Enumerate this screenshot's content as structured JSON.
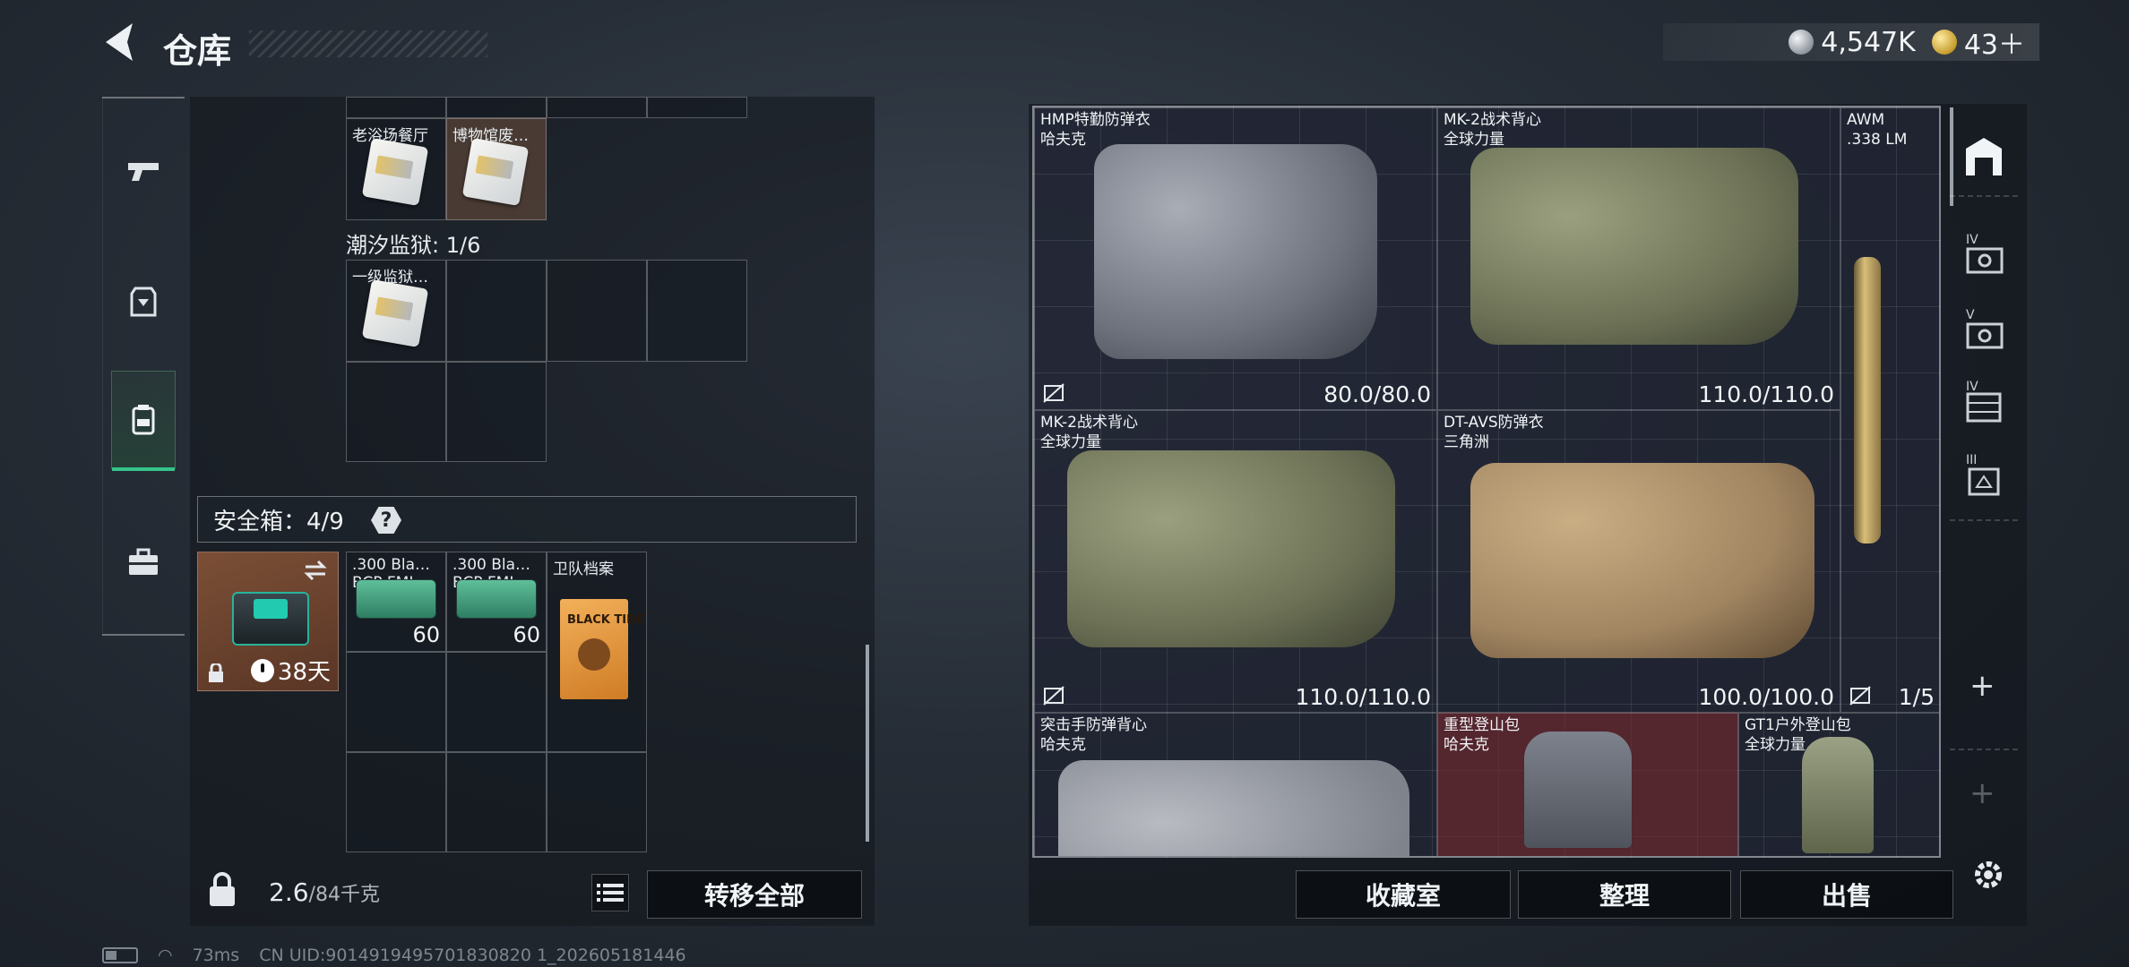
{
  "header": {
    "title": "仓库",
    "currency": [
      {
        "icon": "silver-coin-icon",
        "value": "4,547K"
      },
      {
        "icon": "gold-coin-icon",
        "value": "43＋"
      }
    ]
  },
  "left_rail": {
    "items": [
      {
        "icon": "pistol-icon"
      },
      {
        "icon": "armor-icon"
      },
      {
        "icon": "backpack-icon",
        "active": true
      },
      {
        "icon": "briefcase-icon"
      }
    ]
  },
  "stash": {
    "top_items": [
      {
        "label": "老浴场餐厅",
        "card_color": "#cfd3d6"
      },
      {
        "label": "博物馆废…",
        "card_color": "#e8c27a"
      }
    ],
    "prison_label": "潮汐监狱: 1/6",
    "prison_items": [
      {
        "label": "一级监狱…"
      }
    ]
  },
  "safe_box": {
    "label": "安全箱：4/9",
    "help": "?",
    "container_days": "38天",
    "items": [
      {
        "label": ".300 Bla…",
        "sublabel": "BCP FMJ",
        "count": "60"
      },
      {
        "label": ".300 Bla…",
        "sublabel": "BCP FMJ",
        "count": "60"
      },
      {
        "label": "卫队档案",
        "doc_text": "BLACK TIDE"
      }
    ]
  },
  "footer_left": {
    "weight": "2.6",
    "weight_cap": "/84千克",
    "transfer_all": "转移全部"
  },
  "right_items": [
    {
      "name": "HMP特勤防弹衣",
      "maker": "哈夫克",
      "durability": "80.0/80.0"
    },
    {
      "name": "MK-2战术背心",
      "maker": "全球力量",
      "durability": "110.0/110.0"
    },
    {
      "name": "AWM",
      "maker": ".338 LM",
      "count": "1/5"
    },
    {
      "name": "MK-2战术背心",
      "maker": "全球力量",
      "durability": "110.0/110.0"
    },
    {
      "name": "DT-AVS防弹衣",
      "maker": "三角洲",
      "durability": "100.0/100.0"
    },
    {
      "name": "突击手防弹背心",
      "maker": "哈夫克"
    },
    {
      "name": "重型登山包",
      "maker": "哈夫克"
    },
    {
      "name": "GT1户外登山包",
      "maker": "全球力量"
    }
  ],
  "right_rail": {
    "tiers": [
      "IV",
      "V",
      "IV",
      "III"
    ],
    "plus": "+"
  },
  "footer_right": {
    "collection": "收藏室",
    "organize": "整理",
    "sell": "出售"
  },
  "status_bar": {
    "ping": "73ms",
    "uid": "CN UID:9014919495701830820 1_202605181446"
  }
}
